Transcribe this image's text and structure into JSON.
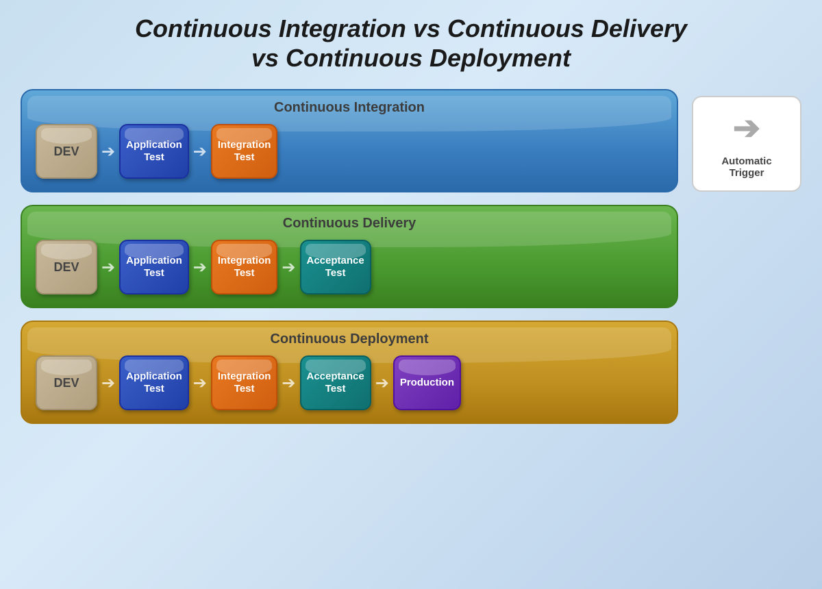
{
  "title": {
    "line1": "Continuous Integration vs Continuous Delivery",
    "line2": "vs Continuous Deployment"
  },
  "ci": {
    "title": "Continuous Integration",
    "stages": [
      {
        "id": "dev",
        "label": "DEV"
      },
      {
        "id": "apptest",
        "label": "Application\nTest"
      },
      {
        "id": "inttest",
        "label": "Integration\nTest"
      }
    ]
  },
  "cd": {
    "title": "Continuous Delivery",
    "stages": [
      {
        "id": "dev",
        "label": "DEV"
      },
      {
        "id": "apptest",
        "label": "Application\nTest"
      },
      {
        "id": "inttest",
        "label": "Integration\nTest"
      },
      {
        "id": "acctest",
        "label": "Acceptance\nTest"
      }
    ]
  },
  "cdeploy": {
    "title": "Continuous Deployment",
    "stages": [
      {
        "id": "dev",
        "label": "DEV"
      },
      {
        "id": "apptest",
        "label": "Application\nTest"
      },
      {
        "id": "inttest",
        "label": "Integration\nTest"
      },
      {
        "id": "acctest",
        "label": "Acceptance\nTest"
      },
      {
        "id": "production",
        "label": "Production"
      }
    ]
  },
  "trigger": {
    "label": "Automatic Trigger",
    "icon": "➔"
  }
}
